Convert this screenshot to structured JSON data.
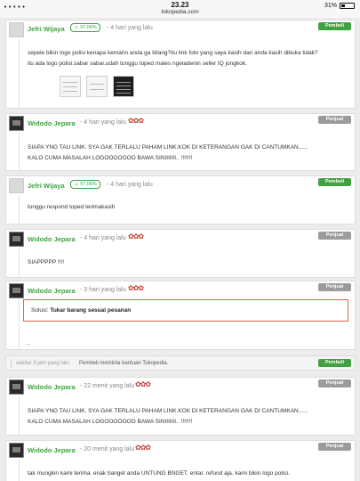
{
  "status_bar": {
    "carrier": "•••••",
    "time": "23.23",
    "url": "tokopedia.com",
    "battery": "31%"
  },
  "colors": {
    "pembeli": "#42a142",
    "penjual": "#9b9b9b",
    "solution_border": "#e8623a",
    "name": "#42a142"
  },
  "comments": [
    {
      "name": "Jefri Wijaya",
      "reputation": "97,06%",
      "time": "- 4 hari yang lalu",
      "badge": "Pembeli",
      "lines": [
        "sepele bikin logo polisi kenapa kemarin anda ga bilang?itu link foto yang saya kasih dan anda kasih dibuka tidak?",
        "itu ada logo polisi.sabar sabar.udah tunggu toped males ngeladenin seller IQ jongkok."
      ],
      "thumbnails": [
        "thumbnail-1",
        "thumbnail-2",
        "thumbnail-3"
      ]
    },
    {
      "name": "Widodo Jepara",
      "time": "- 4 hari yang lalu",
      "badge": "Penjual",
      "lines": [
        "SIAPA YNG TAU LINK. SYA GAK TERLALU PAHAM LINK.KOK DI KETERANGAN GAK DI CANTUMKAN......",
        "KALO CUMA MASALAH LOGOOOOOOO BAWA SINIIIIIII.. !!!!!!!"
      ]
    },
    {
      "name": "Jefri Wijaya",
      "reputation": "97,06%",
      "time": "- 4 hari yang lalu",
      "badge": "Pembeli",
      "lines": [
        "tunggu respond toped terimakasih"
      ]
    },
    {
      "name": "Widodo Jepara",
      "time": "- 4 hari yang lalu",
      "badge": "Penjual",
      "lines": [
        "SIAPPPPP !!!!"
      ]
    },
    {
      "name": "Widodo Jepara",
      "time": "- 3 hari yang lalu",
      "badge": "Penjual",
      "solution_label": "Solusi:",
      "solution_value": "Tukar barang sesuai pesanan",
      "lines": [
        "-"
      ]
    },
    {
      "name": "Widodo Jepara",
      "time": "- 22 menit yang lalu",
      "badge": "Penjual",
      "lines": [
        "SIAPA YNG TAU LINK. SYA GAK TERLALU PAHAM LINK.KOK DI KETERANGAN GAK DI CANTUMKAN......",
        "KALO CUMA MASALAH LOGOOOOOOO BAWA SINIIIIIII.. !!!!!!!"
      ]
    },
    {
      "name": "Widodo Jepara",
      "time": "- 20 menit yang lalu",
      "badge": "Penjual",
      "lines": [
        "tak mungkin kami terima. enak banget anda UNTUNG BNGET. entar. refund aja. kami bikin logo polisi."
      ]
    }
  ],
  "system_event": {
    "time": "sekitar 3 jam yang lalu",
    "text": "Pembeli meminta bantuan Tokopedia.",
    "badge": "Pembeli"
  }
}
